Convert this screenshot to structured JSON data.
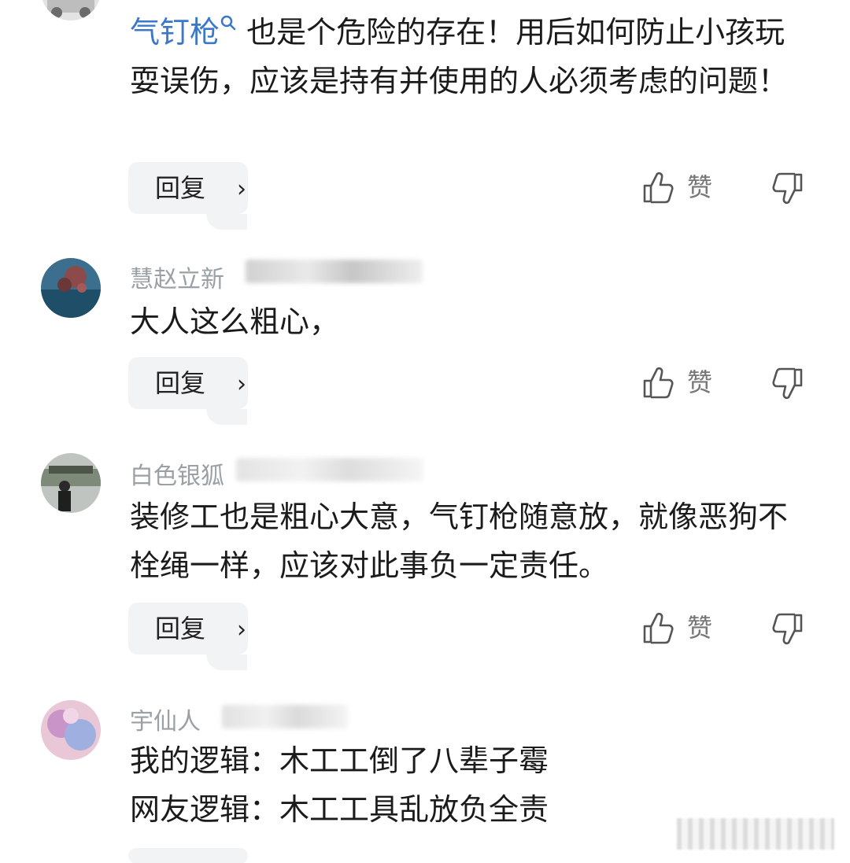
{
  "comments": [
    {
      "username": "",
      "link_text": "气钉枪",
      "text": "也是个危险的存在！用后如何防止小孩玩耍误伤，应该是持有并使用的人必须考虑的问题！",
      "reply_label": "回复",
      "like_label": "赞"
    },
    {
      "username": "慧赵立新",
      "text": "大人这么粗心，",
      "reply_label": "回复",
      "like_label": "赞"
    },
    {
      "username": "白色银狐",
      "text": "装修工也是粗心大意，气钉枪随意放，就像恶狗不栓绳一样，应该对此事负一定责任。",
      "reply_label": "回复",
      "like_label": "赞"
    },
    {
      "username": "宇仙人",
      "text_line1": "我的逻辑：木工工倒了八辈子霉",
      "text_line2": "网友逻辑：木工工具乱放负全责"
    }
  ],
  "icons": {
    "like": "thumbs-up-icon",
    "dislike": "thumbs-down-icon",
    "search": "search-icon",
    "chevron": "chevron-right-icon"
  },
  "colors": {
    "link": "#3b78c9",
    "text": "#1b1b1b",
    "meta": "#9aa0a6",
    "button_bg": "#f2f3f5"
  }
}
